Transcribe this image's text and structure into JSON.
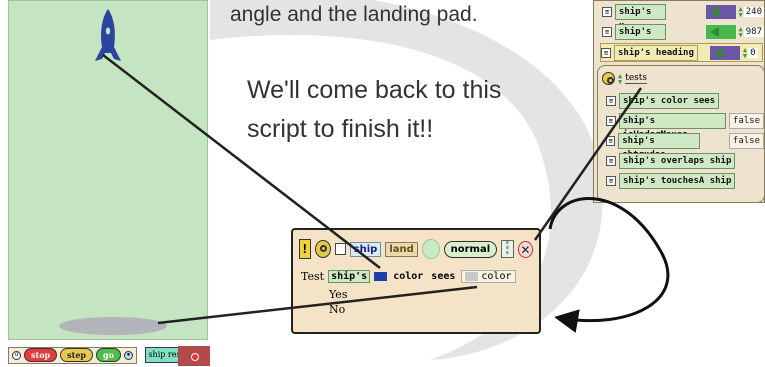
{
  "instructions": {
    "line1": "angle and the landing pad.",
    "line2": "We'll come back to this",
    "line3": "script to finish it!!"
  },
  "controls": {
    "stop_label": "stop",
    "step_label": "step",
    "go_label": "go",
    "ship_reset_label": "ship reset"
  },
  "viewer": {
    "rows": [
      {
        "label": "ship's x",
        "value": "240"
      },
      {
        "label": "ship's y",
        "value": "987"
      },
      {
        "label": "ship's heading",
        "value": "0"
      }
    ],
    "tests_label": "tests",
    "tests": [
      {
        "label": "ship's color sees",
        "value": ""
      },
      {
        "label": "ship's isUnderMouse",
        "value": "false"
      },
      {
        "label": "ship's obtrudes",
        "value": "false"
      },
      {
        "label": "ship's overlaps ship",
        "value": ""
      },
      {
        "label": "ship's touchesA ship",
        "value": ""
      }
    ]
  },
  "script": {
    "object_name": "ship",
    "script_name": "land",
    "status": "normal",
    "test_label": "Test",
    "ships_label": "ship's",
    "color_label": "color",
    "sees_label": "sees",
    "color_value_label": "color",
    "yes_label": "Yes",
    "no_label": "No"
  },
  "colors": {
    "stage_bg": "#c5e5c2",
    "rocket": "#2a44a0",
    "script_bg": "#f5e3c8",
    "ship_color_chip": "#1c3fa8",
    "tile_green": "#cfe9c4"
  }
}
